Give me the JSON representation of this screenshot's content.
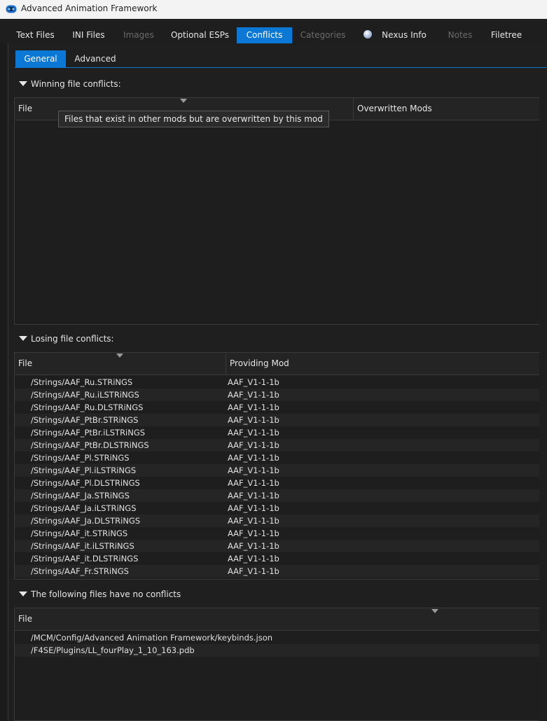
{
  "window": {
    "title": "Advanced Animation Framework"
  },
  "tabs": [
    {
      "label": "Text Files",
      "state": "normal"
    },
    {
      "label": "INI Files",
      "state": "normal"
    },
    {
      "label": "Images",
      "state": "disabled"
    },
    {
      "label": "Optional ESPs",
      "state": "normal"
    },
    {
      "label": "Conflicts",
      "state": "active"
    },
    {
      "label": "Categories",
      "state": "disabled"
    },
    {
      "label": "Nexus Info",
      "state": "normal",
      "icon": "globe-icon"
    },
    {
      "label": "Notes",
      "state": "disabled"
    },
    {
      "label": "Filetree",
      "state": "normal"
    }
  ],
  "subtabs": [
    {
      "label": "General",
      "state": "active"
    },
    {
      "label": "Advanced",
      "state": "inactive"
    }
  ],
  "winning": {
    "header": "Winning file conflicts:",
    "columns": [
      "File",
      "Overwritten Mods"
    ],
    "rows": []
  },
  "tooltip": "Files that exist in other mods but are overwritten by this mod",
  "losing": {
    "header": "Losing file conflicts:",
    "columns": [
      "File",
      "Providing Mod"
    ],
    "rows": [
      [
        "/Strings/AAF_Ru.STRiNGS",
        "AAF_V1-1-1b"
      ],
      [
        "/Strings/AAF_Ru.iLSTRiNGS",
        "AAF_V1-1-1b"
      ],
      [
        "/Strings/AAF_Ru.DLSTRiNGS",
        "AAF_V1-1-1b"
      ],
      [
        "/Strings/AAF_PtBr.STRiNGS",
        "AAF_V1-1-1b"
      ],
      [
        "/Strings/AAF_PtBr.iLSTRiNGS",
        "AAF_V1-1-1b"
      ],
      [
        "/Strings/AAF_PtBr.DLSTRiNGS",
        "AAF_V1-1-1b"
      ],
      [
        "/Strings/AAF_Pl.STRiNGS",
        "AAF_V1-1-1b"
      ],
      [
        "/Strings/AAF_Pl.iLSTRiNGS",
        "AAF_V1-1-1b"
      ],
      [
        "/Strings/AAF_Pl.DLSTRiNGS",
        "AAF_V1-1-1b"
      ],
      [
        "/Strings/AAF_Ja.STRiNGS",
        "AAF_V1-1-1b"
      ],
      [
        "/Strings/AAF_Ja.iLSTRiNGS",
        "AAF_V1-1-1b"
      ],
      [
        "/Strings/AAF_Ja.DLSTRiNGS",
        "AAF_V1-1-1b"
      ],
      [
        "/Strings/AAF_it.STRiNGS",
        "AAF_V1-1-1b"
      ],
      [
        "/Strings/AAF_it.iLSTRiNGS",
        "AAF_V1-1-1b"
      ],
      [
        "/Strings/AAF_it.DLSTRiNGS",
        "AAF_V1-1-1b"
      ],
      [
        "/Strings/AAF_Fr.STRiNGS",
        "AAF_V1-1-1b"
      ]
    ]
  },
  "noconflict": {
    "header": "The following files have no conflicts",
    "columns": [
      "File"
    ],
    "rows": [
      [
        "/MCM/Config/Advanced Animation Framework/keybinds.json"
      ],
      [
        "/F4SE/Plugins/LL_fourPlay_1_10_163.pdb"
      ]
    ]
  },
  "colors": {
    "accent": "#0a78d4",
    "background": "#1b1b1b",
    "disabled_text": "#6b6b6b"
  }
}
